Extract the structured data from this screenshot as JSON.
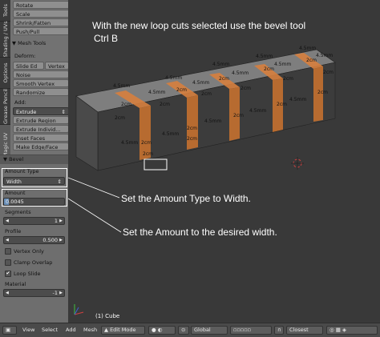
{
  "vtabs": [
    "Magic UV",
    "Grease Pencil",
    "Options",
    "Shading / UVs",
    "Tools"
  ],
  "shelf": {
    "transform_buttons": [
      "Rotate",
      "Scale",
      "Shrink/Fatten",
      "Push/Pull"
    ],
    "mesh_tools_header": "Mesh Tools",
    "deform_label": "Deform:",
    "slide_edge": "Slide Ed",
    "vertex": "Vertex",
    "noise": "Noise",
    "smooth_vertex": "Smooth Vertex",
    "randomize": "Randomize",
    "add_label": "Add:",
    "extrude": "Extrude",
    "extrude_region": "Extrude Region",
    "extrude_individual": "Extrude Individ...",
    "inset_faces": "Inset Faces",
    "make_edge_face": "Make Edge/Face"
  },
  "bevel": {
    "header": "Bevel",
    "amount_type_label": "Amount Type",
    "amount_type_value": "Width",
    "amount_label": "Amount",
    "amount_value": "0.0045",
    "segments_label": "Segments",
    "segments_value": "1",
    "profile_label": "Profile",
    "profile_value": "0.500",
    "vertex_only": "Vertex Only",
    "clamp_overlap": "Clamp Overlap",
    "loop_slide": "Loop Slide",
    "material_label": "Material",
    "material_value": "-1"
  },
  "viewport": {
    "instruction_1": "With the new loop cuts selected use the bevel tool",
    "instruction_2": "Ctrl B",
    "annotation_amount_type": "Set the Amount Type to Width.",
    "annotation_amount": "Set the Amount to the desired width.",
    "object_label": "(1) Cube",
    "dim_2cm": "2cm",
    "dim_45mm": "4.5mm"
  },
  "header_bar": {
    "view": "View",
    "select": "Select",
    "add": "Add",
    "mesh": "Mesh",
    "mode": "Edit Mode",
    "orientation": "Global",
    "snap": "Closest"
  },
  "colors": {
    "edge_highlight": "#e8893a",
    "selection_box": "#ffffff"
  }
}
